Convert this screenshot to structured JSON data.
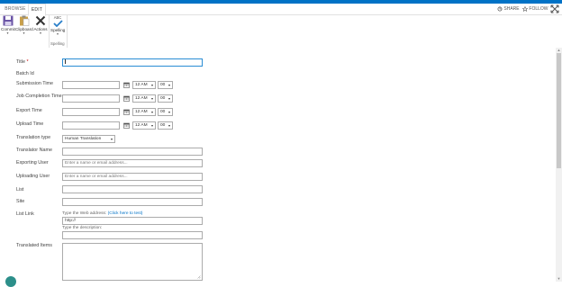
{
  "tabs": [
    "BROWSE",
    "EDIT"
  ],
  "header_actions": {
    "share": "SHARE",
    "follow": "FOLLOW"
  },
  "ribbon": {
    "commit": "Commit",
    "clipboard": "Clipboard",
    "actions": "Actions",
    "spelling_icon_text": "ABC",
    "spelling": "Spelling",
    "spelling_group": "Spelling",
    "dropdown_arrow": "▾"
  },
  "form": {
    "title_label": "Title",
    "required_mark": " *",
    "batch_id_label": "Batch Id",
    "submission_time_label": "Submission Time",
    "job_completion_time_label": "Job Completion Time",
    "export_time_label": "Export Time",
    "upload_time_label": "Upload Time",
    "hour_value": "12 AM",
    "minute_value": "00",
    "translation_type_label": "Translation type",
    "translation_type_value": "Human Translation",
    "translator_name_label": "Translator Name",
    "exporting_user_label": "Exporting User",
    "uploading_user_label": "Uploading User",
    "people_placeholder": "Enter a name or email address...",
    "list_label": "List",
    "site_label": "Site",
    "list_link_label": "List Link",
    "web_address_hint": "Type the Web address:",
    "click_to_test": "(Click here to test)",
    "url_value": "http://",
    "description_hint": "Type the description:",
    "translated_items_label": "Translated Items"
  }
}
